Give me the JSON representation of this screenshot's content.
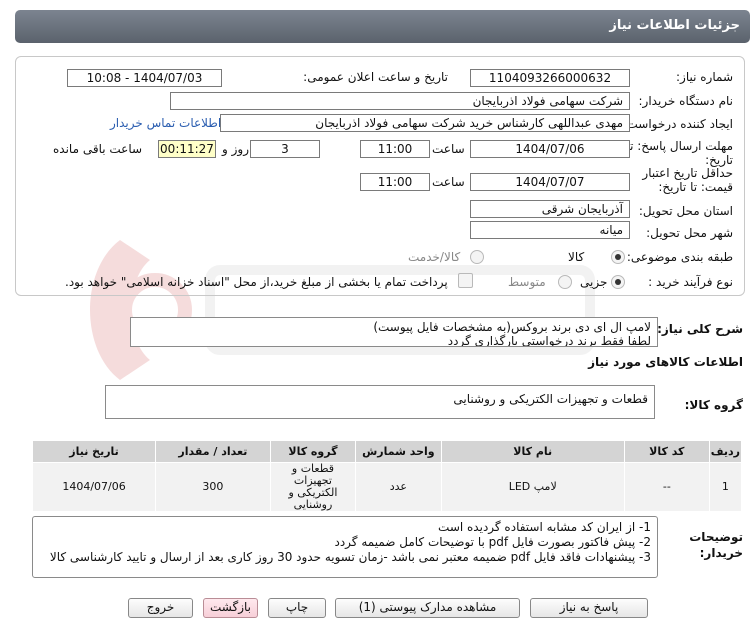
{
  "header": {
    "title": "جزئیات اطلاعات نیاز"
  },
  "fields": {
    "need_number_label": "شماره نیاز:",
    "need_number": "1104093266000632",
    "announce_label": "تاریخ و ساعت اعلان عمومی:",
    "announce_value": "1404/07/03 - 10:08",
    "buyer_org_label": "نام دستگاه خریدار:",
    "buyer_org": "شرکت سهامی فولاد اذربایجان",
    "creator_label": "ایجاد کننده درخواست:",
    "creator": "مهدی عبداللهی کارشناس خرید شرکت سهامی فولاد اذربایجان",
    "contact_link": "اطلاعات تماس خریدار",
    "deadline_label": "مهلت ارسال پاسخ: تا",
    "deadline_label2": "تاریخ:",
    "deadline_date": "1404/07/06",
    "time_label": "ساعت",
    "deadline_time": "11:00",
    "days_value": "3",
    "days_label": "روز و",
    "remaining_time": "00:11:27",
    "remaining_label": "ساعت باقی مانده",
    "validity_label": "حداقل تاریخ اعتبار",
    "validity_label2": "قیمت: تا تاریخ:",
    "validity_date": "1404/07/07",
    "validity_time": "11:00",
    "province_label": "استان محل تحویل:",
    "province": "آذربایجان شرقی",
    "city_label": "شهر محل تحویل:",
    "city": "میانه",
    "category_label": "طبقه بندی موضوعی:",
    "category_options": [
      "کالا",
      "کالا/خدمت"
    ],
    "process_label": "نوع فرآیند خرید :",
    "process_options": [
      "جزیی",
      "متوسط"
    ],
    "payment_note": "پرداخت تمام یا بخشی از مبلغ خرید،از محل \"اسناد خزانه اسلامی\" خواهد بود."
  },
  "description": {
    "label": "شرح کلی نیاز:",
    "line1": "لامپ ال ای دی برند بروکس(به مشخصات فایل پیوست)",
    "line2": "لطفا فقط برند درخواستی بارگذاری گردد"
  },
  "goods": {
    "section_title": "اطلاعات کالاهای مورد نیاز",
    "group_label": "گروه کالا:",
    "group_value": "قطعات و تجهیزات الکتریکی و روشنایی"
  },
  "table": {
    "headers": [
      "ردیف",
      "کد کالا",
      "نام کالا",
      "واحد شمارش",
      "گروه کالا",
      "تعداد / مقدار",
      "تاریخ نیاز"
    ],
    "rows": [
      [
        "1",
        "--",
        "لامپ LED",
        "عدد",
        "قطعات و تجهیزات الکتریکی و روشنایی",
        "300",
        "1404/07/06"
      ]
    ]
  },
  "notes": {
    "label": "توضیحات",
    "label2": "خریدار:",
    "lines": [
      "1- از ایران کد مشابه استفاده گردیده است",
      "2- پیش فاکتور بصورت فایل pdf با توضیحات کامل ضمیمه گردد",
      "3- پیشنهادات فاقد فایل pdf  ضمیمه معتبر نمی باشد -زمان تسویه حدود 30  روز کاری بعد از ارسال و تایید کارشناسی کالا"
    ]
  },
  "buttons": {
    "reply": "پاسخ به نیاز",
    "attachments": "مشاهده مدارک پیوستی (1)",
    "print": "چاپ",
    "back": "بازگشت",
    "exit": "خروج"
  }
}
